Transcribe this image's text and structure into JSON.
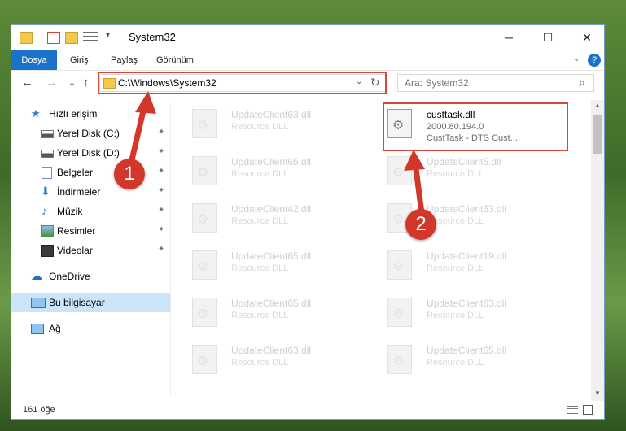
{
  "window": {
    "title": "System32",
    "controls": {
      "minimize": "─",
      "maximize": "☐",
      "close": "✕"
    }
  },
  "ribbon": {
    "tabs": [
      "Dosya",
      "Giriş",
      "Paylaş",
      "Görünüm"
    ],
    "expand_icon": "chevron-down-icon",
    "help_icon": "?"
  },
  "nav": {
    "back": "←",
    "forward": "→",
    "recent": "⌄",
    "up": "↑",
    "address": "C:\\Windows\\System32",
    "refresh": "↻",
    "search_placeholder": "Ara: System32",
    "search_icon": "⌕"
  },
  "sidebar": {
    "items": [
      {
        "label": "Hızlı erişim",
        "icon": "star-icon",
        "pinned": false
      },
      {
        "label": "Yerel Disk (C:)",
        "icon": "drive-icon",
        "pinned": true
      },
      {
        "label": "Yerel Disk (D:)",
        "icon": "drive-icon",
        "pinned": true
      },
      {
        "label": "Belgeler",
        "icon": "documents-icon",
        "pinned": true
      },
      {
        "label": "İndirmeler",
        "icon": "download-icon",
        "pinned": true
      },
      {
        "label": "Müzik",
        "icon": "music-icon",
        "pinned": true
      },
      {
        "label": "Resimler",
        "icon": "pictures-icon",
        "pinned": true
      },
      {
        "label": "Videolar",
        "icon": "video-icon",
        "pinned": true
      },
      {
        "label": "OneDrive",
        "icon": "cloud-icon",
        "pinned": false
      },
      {
        "label": "Bu bilgisayar",
        "icon": "computer-icon",
        "pinned": false,
        "selected": true
      },
      {
        "label": "Ağ",
        "icon": "network-icon",
        "pinned": false
      }
    ],
    "pin_glyph": "📌"
  },
  "files": {
    "left_column": [
      {
        "name": "UpdateClient63.dll",
        "desc": "Resource DLL"
      },
      {
        "name": "UpdateClient65.dll",
        "desc": "Resource DLL"
      },
      {
        "name": "UpdateClient42.dll",
        "desc": "Resource DLL"
      },
      {
        "name": "UpdateClient65.dll",
        "desc": "Resource DLL"
      },
      {
        "name": "UpdateClient65.dll",
        "desc": "Resource DLL"
      },
      {
        "name": "UpdateClient63.dll",
        "desc": "Resource DLL"
      }
    ],
    "right_column": [
      {
        "name": "custtask.dll",
        "version": "2000.80.194.0",
        "desc": "CustTask - DTS Cust...",
        "highlighted": true
      },
      {
        "name": "UpdateClient5.dll",
        "desc": "Resource DLL"
      },
      {
        "name": "UpdateClient63.dll",
        "desc": "Resource DLL"
      },
      {
        "name": "UpdateClient19.dll",
        "desc": "Resource DLL"
      },
      {
        "name": "UpdateClient63.dll",
        "desc": "Resource DLL"
      },
      {
        "name": "UpdateClient65.dll",
        "desc": "Resource DLL"
      }
    ]
  },
  "status": {
    "item_count": "161 öğe"
  },
  "annotations": {
    "step1": "1",
    "step2": "2"
  },
  "colors": {
    "accent": "#1a73c9",
    "highlight_red": "#d8453a",
    "badge_red": "#d3372a",
    "selected_bg": "#cce4f7"
  }
}
